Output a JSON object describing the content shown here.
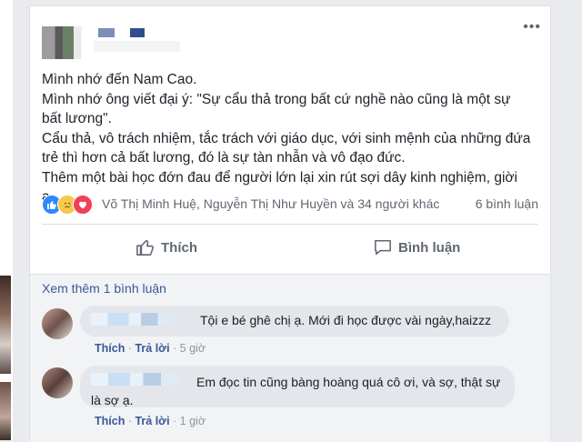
{
  "post": {
    "lines": [
      "Mình nhớ đến Nam Cao.",
      "Mình nhớ ông viết đại ý: \"Sự cẩu thả trong bất cứ nghề nào cũng là một sự bất lương\".",
      "Cẩu thả, vô trách nhiệm, tắc trách với giáo dục, với sinh mệnh của những đứa trẻ thì hơn cả bất lương, đó là sự tàn nhẫn và vô đạo đức.",
      "Thêm một bài học đớn đau để người lớn lại xin rút sợi dây kinh nghiệm, giời ạ."
    ],
    "more_icon": "•••"
  },
  "reactions": {
    "icons": [
      "like-icon",
      "sad-icon",
      "love-icon"
    ],
    "names": "Võ Thị Minh Huệ, Nguyễn Thị Như Huyền và 34 người khác",
    "comment_count": "6 bình luận"
  },
  "actions": {
    "like_label": "Thích",
    "comment_label": "Bình luận"
  },
  "comments": {
    "see_more": "Xem thêm 1 bình luận",
    "items": [
      {
        "text": "Tội e bé ghê chị ạ. Mới đi học được vài ngày,haizzz",
        "like_label": "Thích",
        "reply_label": "Trả lời",
        "time": "5 giờ"
      },
      {
        "text": "Em đọc tin cũng bàng hoàng quá cô ơi, và sợ, thật sự là sợ ạ.",
        "like_label": "Thích",
        "reply_label": "Trả lời",
        "time": "1 giờ"
      }
    ]
  },
  "colors": {
    "link": "#385898",
    "text": "#1d2129",
    "muted": "#606770",
    "like_blue": "#2d88ff",
    "love_red": "#f33e58",
    "sad_yellow": "#f7c94a"
  }
}
